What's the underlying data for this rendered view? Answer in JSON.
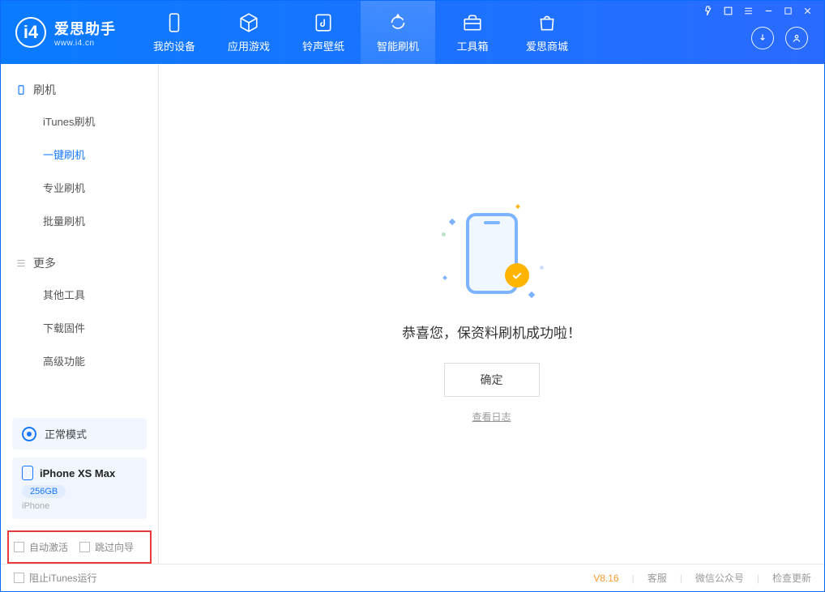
{
  "header": {
    "app_name": "爱思助手",
    "app_url": "www.i4.cn",
    "nav": [
      {
        "label": "我的设备"
      },
      {
        "label": "应用游戏"
      },
      {
        "label": "铃声壁纸"
      },
      {
        "label": "智能刷机"
      },
      {
        "label": "工具箱"
      },
      {
        "label": "爱思商城"
      }
    ]
  },
  "sidebar": {
    "section1_title": "刷机",
    "section1_items": [
      "iTunes刷机",
      "一键刷机",
      "专业刷机",
      "批量刷机"
    ],
    "section2_title": "更多",
    "section2_items": [
      "其他工具",
      "下载固件",
      "高级功能"
    ]
  },
  "device": {
    "mode_label": "正常模式",
    "name": "iPhone XS Max",
    "storage": "256GB",
    "type": "iPhone"
  },
  "options": {
    "auto_activate": "自动激活",
    "skip_guide": "跳过向导"
  },
  "main": {
    "message": "恭喜您，保资料刷机成功啦！",
    "ok_label": "确定",
    "log_link": "查看日志"
  },
  "footer": {
    "block_itunes": "阻止iTunes运行",
    "version": "V8.16",
    "support": "客服",
    "wechat": "微信公众号",
    "check_update": "检查更新"
  }
}
